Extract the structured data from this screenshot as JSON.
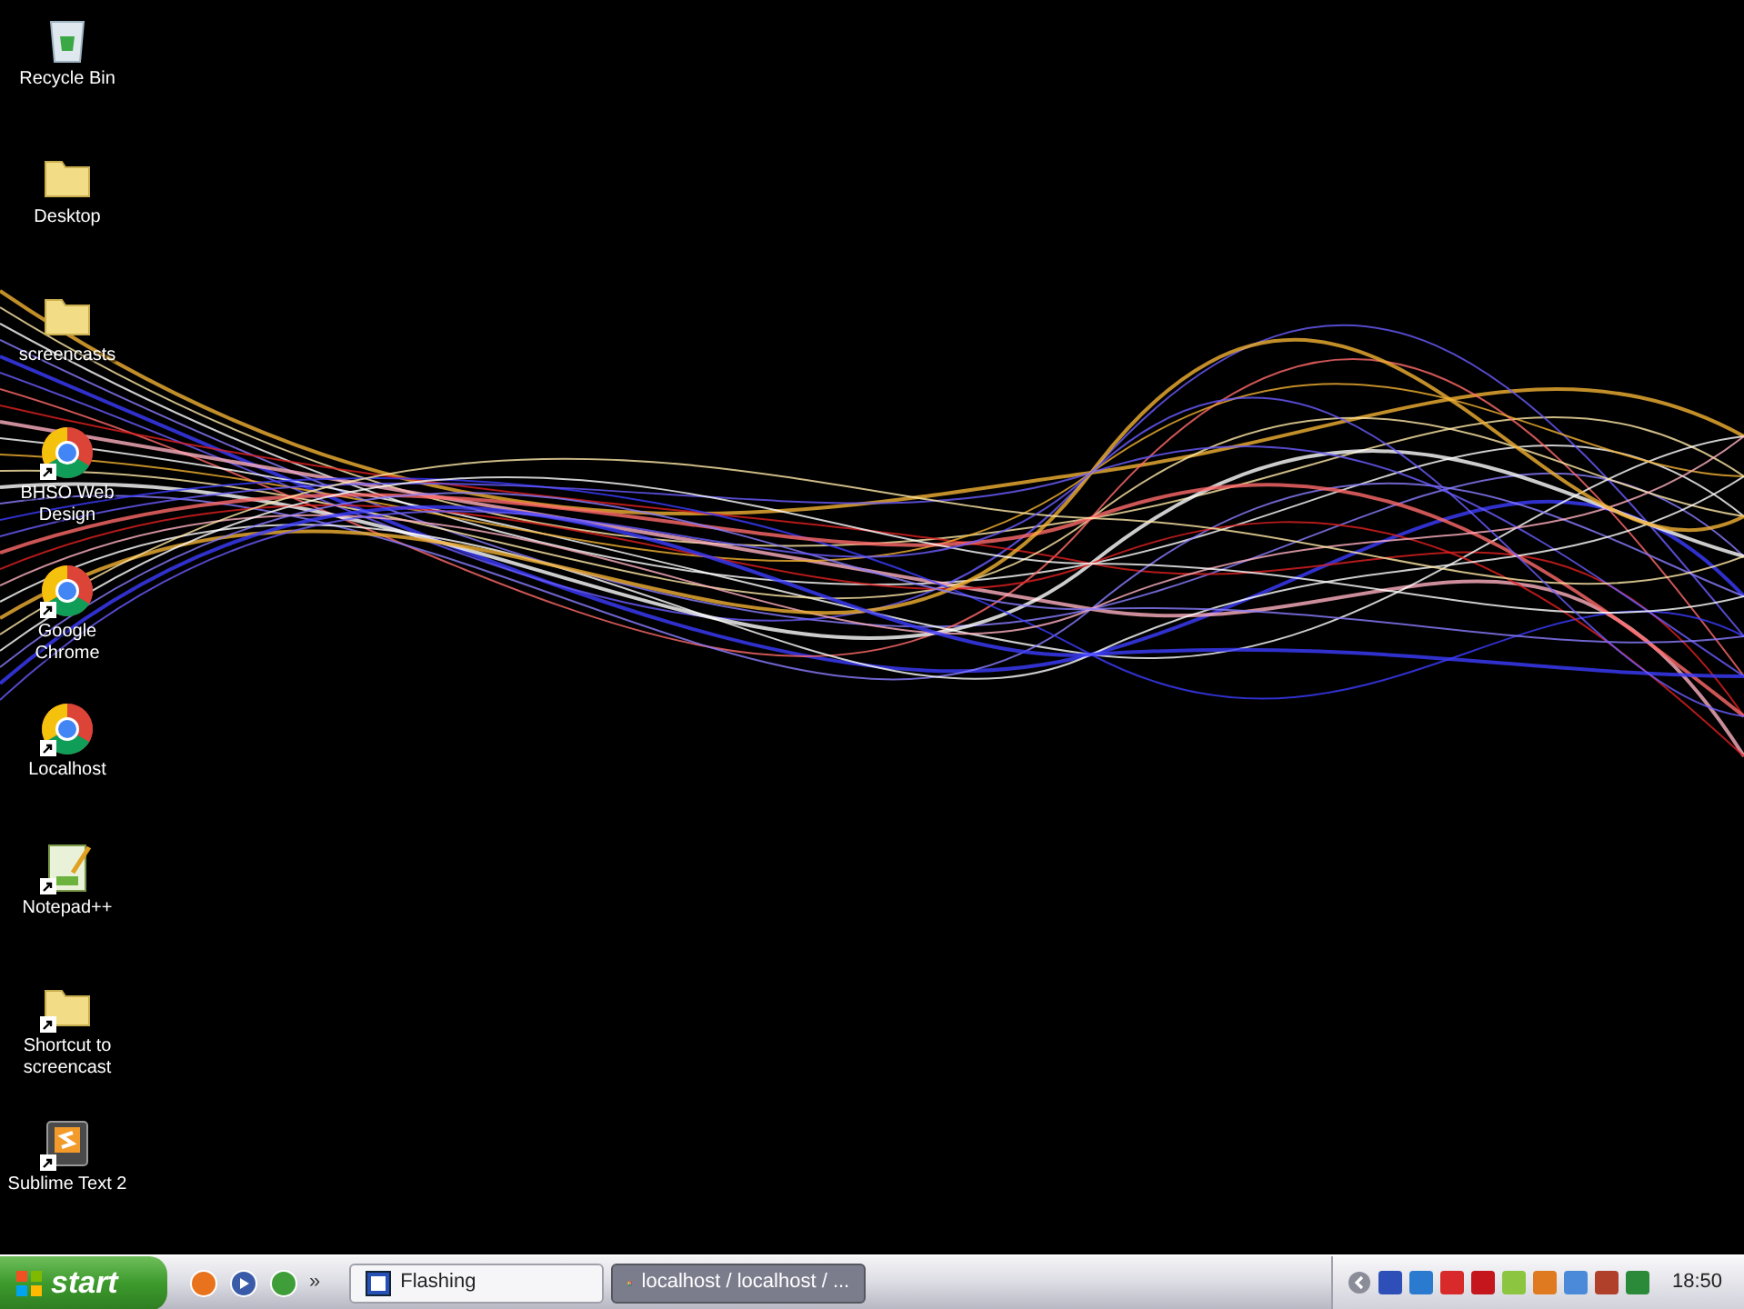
{
  "desktop_icons": [
    {
      "label": "Recycle Bin",
      "kind": "recycle",
      "shortcut": false
    },
    {
      "label": "Desktop",
      "kind": "folder",
      "shortcut": false
    },
    {
      "label": "screencasts",
      "kind": "folder",
      "shortcut": false
    },
    {
      "label": "BHSO Web Design",
      "kind": "chrome",
      "shortcut": true
    },
    {
      "label": "Google Chrome",
      "kind": "chrome",
      "shortcut": true
    },
    {
      "label": "Localhost",
      "kind": "chrome",
      "shortcut": true
    },
    {
      "label": "Notepad++",
      "kind": "notepad",
      "shortcut": true
    },
    {
      "label": "Shortcut to screencast",
      "kind": "folder",
      "shortcut": true
    },
    {
      "label": "Sublime Text 2",
      "kind": "sublime",
      "shortcut": true
    }
  ],
  "taskbar": {
    "start_label": "start",
    "quick_launch": [
      {
        "kind": "firefox"
      },
      {
        "kind": "player"
      },
      {
        "kind": "torrent"
      }
    ],
    "quick_launch_more": "»",
    "windows": [
      {
        "label": "Flashing",
        "kind": "app",
        "selected": false
      },
      {
        "label": "localhost / localhost / ...",
        "kind": "chrome",
        "selected": true
      }
    ],
    "clock": "18:50"
  }
}
